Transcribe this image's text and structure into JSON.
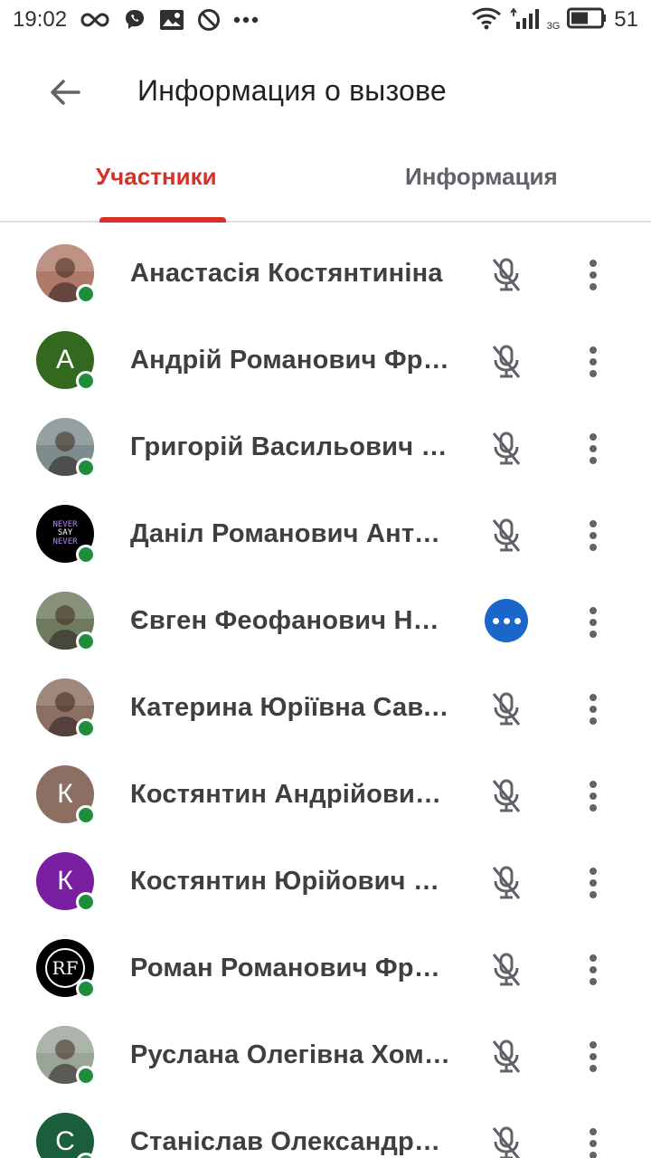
{
  "status_bar": {
    "time": "19:02",
    "battery_percent": "51",
    "network_type": "3G",
    "left_icons": [
      "infinity-icon",
      "viber-icon",
      "gallery-icon",
      "do-not-disturb-icon",
      "more-dots-icon"
    ],
    "right_icons": [
      "wifi-icon",
      "signal-icon",
      "battery-icon"
    ]
  },
  "app_bar": {
    "title": "Информация о вызове",
    "back_icon": "arrow-back-icon"
  },
  "tabs": [
    {
      "label": "Участники",
      "active": true
    },
    {
      "label": "Информация",
      "active": false
    }
  ],
  "colors": {
    "accent_red": "#d93025",
    "presence_green": "#1e8e3e",
    "speaking_blue": "#1a66c9"
  },
  "participants": [
    {
      "name": "Анастасія Костянтиніна",
      "avatar_type": "photo",
      "avatar_letter": "",
      "avatar_color": "#b07a6a",
      "status": "muted",
      "online": true
    },
    {
      "name": "Андрій Романович Фролов",
      "avatar_type": "letter",
      "avatar_letter": "А",
      "avatar_color": "#33691e",
      "status": "muted",
      "online": true
    },
    {
      "name": "Григорій Васильович Бондар",
      "avatar_type": "photo",
      "avatar_letter": "",
      "avatar_color": "#7f8c8d",
      "status": "muted",
      "online": true
    },
    {
      "name": "Даніл Романович Антонов",
      "avatar_type": "photo-text",
      "avatar_letter": "",
      "avatar_color": "#000000",
      "avatar_text": [
        "NEVER",
        "SAY",
        "NEVER"
      ],
      "status": "muted",
      "online": true
    },
    {
      "name": "Євген Феофанович Науменко",
      "avatar_type": "photo",
      "avatar_letter": "",
      "avatar_color": "#6d7a5e",
      "status": "speaking",
      "online": true
    },
    {
      "name": "Катерина Юріївна Савченко",
      "avatar_type": "photo",
      "avatar_letter": "",
      "avatar_color": "#8d6e63",
      "status": "muted",
      "online": true
    },
    {
      "name": "Костянтин Андрійович Ковальчук",
      "avatar_type": "letter",
      "avatar_letter": "К",
      "avatar_color": "#8d6e63",
      "status": "muted",
      "online": true
    },
    {
      "name": "Костянтин Юрійович Мельник",
      "avatar_type": "letter",
      "avatar_letter": "К",
      "avatar_color": "#7b1fa2",
      "status": "muted",
      "online": true
    },
    {
      "name": "Роман Романович Фролов",
      "avatar_type": "photo-text",
      "avatar_letter": "",
      "avatar_color": "#000000",
      "avatar_text": [
        "RF"
      ],
      "status": "muted",
      "online": true
    },
    {
      "name": "Руслана Олегівна Хоменко",
      "avatar_type": "photo",
      "avatar_letter": "",
      "avatar_color": "#9aa59a",
      "status": "muted",
      "online": true
    },
    {
      "name": "Станіслав Олександрович",
      "avatar_type": "letter",
      "avatar_letter": "С",
      "avatar_color": "#1b5e3b",
      "status": "muted",
      "online": true
    }
  ]
}
